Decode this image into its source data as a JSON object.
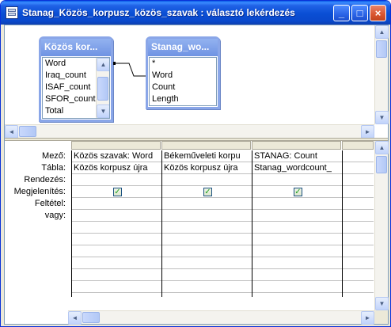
{
  "window": {
    "title": "Stanag_Közös_korpusz_közös_szavak : választó lekérdezés",
    "buttons": {
      "minimize": "_",
      "maximize": "□",
      "close": "×"
    }
  },
  "tables": [
    {
      "title": "Közös kor...",
      "fields": [
        "Word",
        "Iraq_count",
        "ISAF_count",
        "SFOR_count",
        "Total"
      ]
    },
    {
      "title": "Stanag_wo...",
      "fields": [
        "*",
        "Word",
        "Count",
        "Length"
      ]
    }
  ],
  "grid": {
    "row_labels": [
      "Mező:",
      "Tábla:",
      "Rendezés:",
      "Megjelenítés:",
      "Feltétel:",
      "vagy:"
    ],
    "columns": [
      {
        "field": "Közös szavak: Word",
        "table": "Közös korpusz újra",
        "sort": "",
        "show": true
      },
      {
        "field": "Békeműveleti korpu",
        "table": "Közös korpusz újra",
        "sort": "",
        "show": true
      },
      {
        "field": "STANAG: Count",
        "table": "Stanag_wordcount_",
        "sort": "",
        "show": true
      },
      {
        "field": "",
        "table": "",
        "sort": "",
        "show": false
      }
    ]
  },
  "icons": {
    "app": "query-grid-icon",
    "check": "✓",
    "arrow_up": "▲",
    "arrow_down": "▼",
    "arrow_left": "◄",
    "arrow_right": "►"
  }
}
